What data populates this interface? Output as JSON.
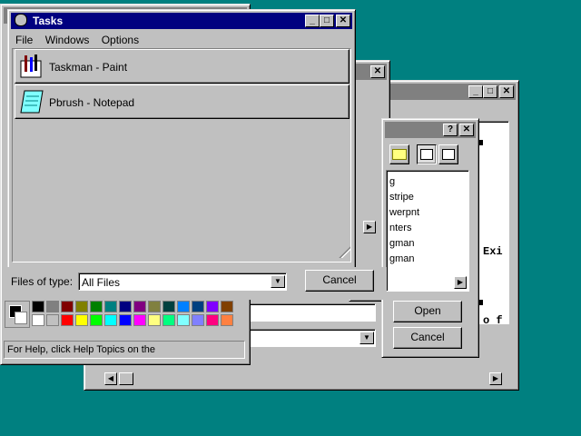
{
  "back_window": {
    "text_lines": [
      "Exi",
      "o f"
    ],
    "buttons": {
      "open": "Open",
      "cancel": "Cancel"
    }
  },
  "mid_window": {
    "list_items": [
      "g",
      "stripe",
      "werpnt",
      "nters",
      "gman",
      "gman"
    ],
    "help": "?",
    "close": "✕"
  },
  "paint_window": {
    "status": "For Help, click Help Topics on the H",
    "palette_top": [
      "#000000",
      "#808080",
      "#800000",
      "#808000",
      "#008000",
      "#008080",
      "#000080",
      "#800080",
      "#808040",
      "#004040",
      "#0080ff",
      "#004080",
      "#8000ff",
      "#804000"
    ],
    "palette_bottom": [
      "#ffffff",
      "#c0c0c0",
      "#ff0000",
      "#ffff00",
      "#00ff00",
      "#00ffff",
      "#0000ff",
      "#ff00ff",
      "#ffff80",
      "#00ff80",
      "#80ffff",
      "#8080ff",
      "#ff0080",
      "#ff8040"
    ]
  },
  "tasks_window": {
    "title": "Tasks",
    "menu": [
      "File",
      "Windows",
      "Options"
    ],
    "items": [
      {
        "label": "Taskman - Paint",
        "icon": "paint-icon"
      },
      {
        "label": "Pbrush - Notepad",
        "icon": "notepad-icon"
      }
    ],
    "files_of_type_label": "Files of type:",
    "files_of_type_value": "All Files",
    "cancel": "Cancel"
  },
  "colors": {
    "desktop": "#008080",
    "titlebar_active": "#000080",
    "titlebar_inactive": "#808080",
    "face": "#c0c0c0"
  }
}
